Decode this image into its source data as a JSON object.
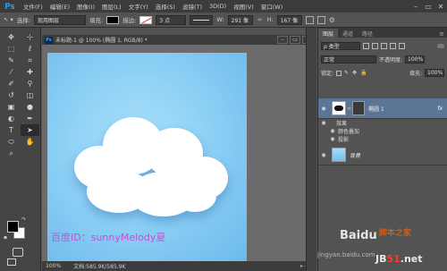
{
  "app": {
    "logo": "Ps",
    "menu": [
      "文件(F)",
      "编辑(E)",
      "图像(I)",
      "图层(L)",
      "文字(Y)",
      "选择(S)",
      "滤镜(T)",
      "3D(D)",
      "视图(V)",
      "窗口(W)"
    ]
  },
  "options_bar": {
    "select_label": "选择:",
    "select_value": "现用图层",
    "fill_label": "填充:",
    "stroke_label": "描边:",
    "stroke_width": "3 点",
    "w_label": "W:",
    "w_value": "291 像",
    "h_label": "H:",
    "h_value": "167 像"
  },
  "document": {
    "icon": "Ps",
    "title": "未标题-1 @ 100% (椭圆 1, RGB/8) *",
    "zoom": "100%",
    "doc_info": "文档:585.9K/585.9K",
    "watermark": "百度ID：sunnyMelody夏"
  },
  "panels": {
    "tabs": [
      "图层",
      "通道",
      "路径"
    ],
    "filter_type": "ρ 类型",
    "blend_mode": "正常",
    "opacity_label": "不透明度:",
    "opacity_value": "100%",
    "lock_label": "锁定:",
    "fill_label": "填充:",
    "fill_value": "100%"
  },
  "layers": [
    {
      "name": "椭圆 1",
      "fx": "fx"
    },
    {
      "name": "背景"
    }
  ],
  "effects": {
    "header": "效果",
    "items": [
      "颜色叠加",
      "投影"
    ]
  },
  "overlay": {
    "baidu": "Baidu",
    "jiaoben": "脚本之家",
    "site_left": "jingyan.baidu.com",
    "site_right_a": "JB",
    "site_right_b": "51",
    "site_right_c": ".net"
  },
  "colors": {
    "canvas_light": "#aee2fb",
    "canvas_dark": "#6cbaea",
    "selected_layer": "#5b7597",
    "watermark": "#c74fd6"
  }
}
